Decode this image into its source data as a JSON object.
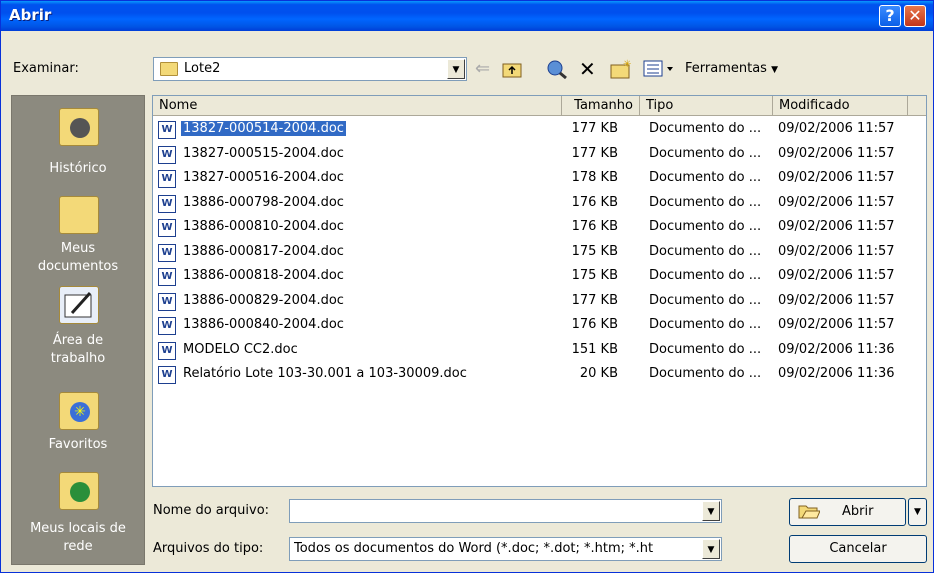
{
  "window": {
    "title": "Abrir",
    "help_glyph": "?",
    "close_glyph": "✕"
  },
  "toolbar": {
    "look_in_label": "Examinar:",
    "location": "Lote2",
    "tools_label": "Ferramentas"
  },
  "places": [
    {
      "label1": "Histórico",
      "label2": ""
    },
    {
      "label1": "Meus",
      "label2": "documentos"
    },
    {
      "label1": "Área de",
      "label2": "trabalho"
    },
    {
      "label1": "Favoritos",
      "label2": ""
    },
    {
      "label1": "Meus locais de",
      "label2": "rede"
    }
  ],
  "columns": {
    "name": "Nome",
    "size": "Tamanho",
    "type": "Tipo",
    "modified": "Modificado"
  },
  "files": [
    {
      "name": "13827-000514-2004.doc",
      "size": "177 KB",
      "type": "Documento do ...",
      "modified": "09/02/2006 11:57"
    },
    {
      "name": "13827-000515-2004.doc",
      "size": "177 KB",
      "type": "Documento do ...",
      "modified": "09/02/2006 11:57"
    },
    {
      "name": "13827-000516-2004.doc",
      "size": "178 KB",
      "type": "Documento do ...",
      "modified": "09/02/2006 11:57"
    },
    {
      "name": "13886-000798-2004.doc",
      "size": "176 KB",
      "type": "Documento do ...",
      "modified": "09/02/2006 11:57"
    },
    {
      "name": "13886-000810-2004.doc",
      "size": "176 KB",
      "type": "Documento do ...",
      "modified": "09/02/2006 11:57"
    },
    {
      "name": "13886-000817-2004.doc",
      "size": "175 KB",
      "type": "Documento do ...",
      "modified": "09/02/2006 11:57"
    },
    {
      "name": "13886-000818-2004.doc",
      "size": "175 KB",
      "type": "Documento do ...",
      "modified": "09/02/2006 11:57"
    },
    {
      "name": "13886-000829-2004.doc",
      "size": "177 KB",
      "type": "Documento do ...",
      "modified": "09/02/2006 11:57"
    },
    {
      "name": "13886-000840-2004.doc",
      "size": "176 KB",
      "type": "Documento do ...",
      "modified": "09/02/2006 11:57"
    },
    {
      "name": "MODELO CC2.doc",
      "size": "151 KB",
      "type": "Documento do ...",
      "modified": "09/02/2006 11:36"
    },
    {
      "name": "Relatório Lote 103-30.001 a 103-30009.doc",
      "size": "20 KB",
      "type": "Documento do ...",
      "modified": "09/02/2006 11:36"
    }
  ],
  "file_icon_letter": "W",
  "bottom": {
    "filename_label": "Nome do arquivo:",
    "filename_value": "",
    "filetype_label": "Arquivos do tipo:",
    "filetype_value": "Todos os documentos do Word (*.doc; *.dot; *.htm; *.ht",
    "open_button": "Abrir",
    "cancel_button": "Cancelar"
  },
  "colors": {
    "titlebar": "#0054e3",
    "selection": "#316ac5",
    "places_bg": "#8c8a7f"
  }
}
